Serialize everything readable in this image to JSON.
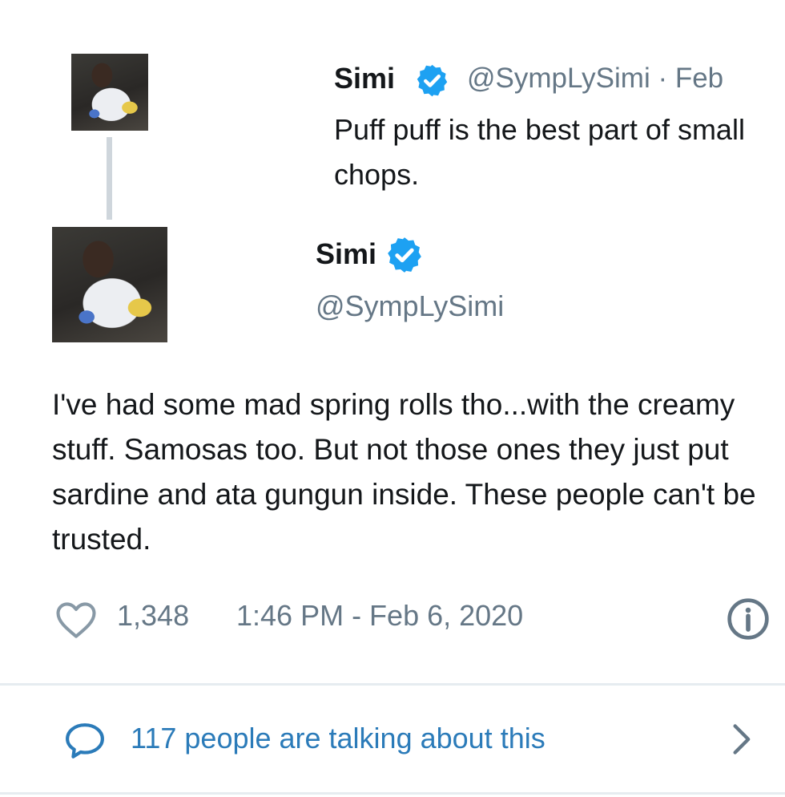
{
  "quoted_tweet": {
    "name": "Simi",
    "handle_date": "@SympLySimi · Feb",
    "text": "Puff puff is the best part of small chops."
  },
  "main_tweet": {
    "name": "Simi",
    "handle": "@SympLySimi",
    "text": "I've had some mad spring rolls tho...with the creamy stuff. Samosas too. But not those ones they just put sardine and ata gungun inside. These people can't be trusted."
  },
  "footer": {
    "like_count": "1,348",
    "timestamp": "1:46 PM - Feb 6, 2020"
  },
  "conversation": {
    "label": "117 people are talking about this"
  },
  "icons": {
    "verified_badge": "verified-badge-icon",
    "heart": "heart-icon",
    "info": "info-icon",
    "chat": "chat-bubble-icon",
    "chevron": "chevron-right-icon"
  },
  "colors": {
    "verified_blue": "#1da1f2",
    "link_blue": "#2b7bb9",
    "secondary_text": "#657786",
    "primary_text": "#14171a",
    "divider": "#e6ecf0"
  }
}
